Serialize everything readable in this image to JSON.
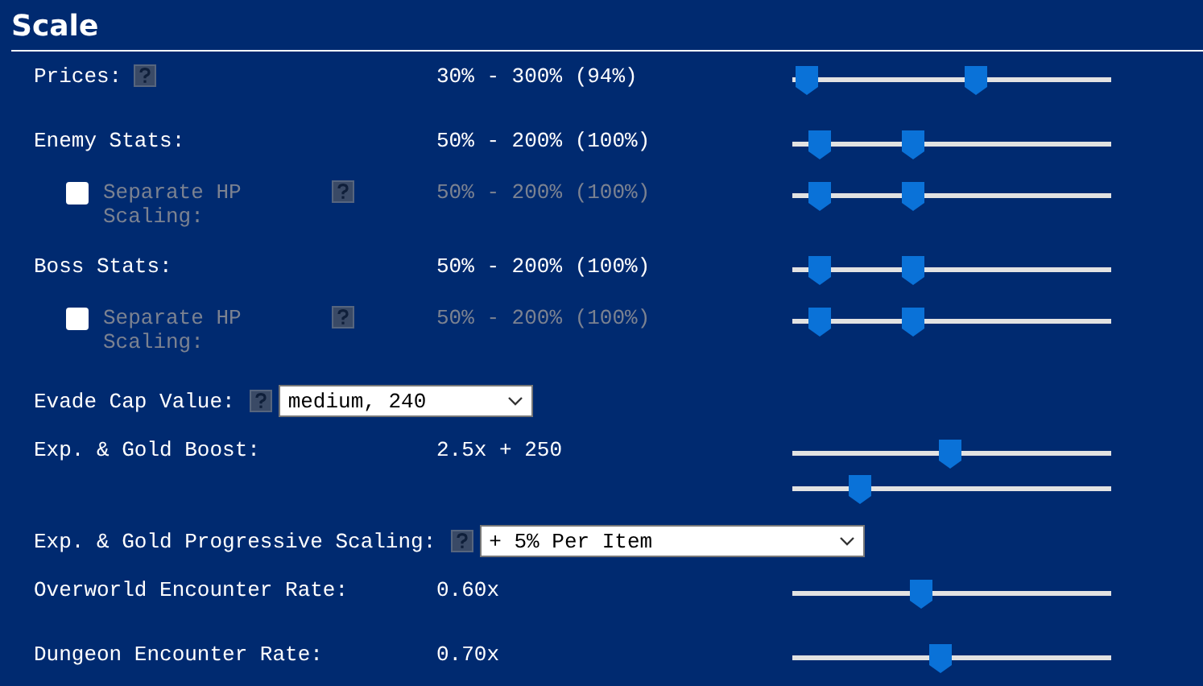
{
  "section": {
    "title": "Scale"
  },
  "rows": [
    {
      "kind": "range",
      "label": "Prices:",
      "help": true,
      "value": "30% - 300% (94%)",
      "disabled": false,
      "sliders": [
        {
          "thumbs": [
            {
              "level": 0.045
            },
            {
              "level": 0.576
            }
          ]
        }
      ]
    },
    {
      "kind": "range",
      "label": "Enemy Stats:",
      "help": false,
      "value": "50% - 200% (100%)",
      "disabled": false,
      "sliders": [
        {
          "thumbs": [
            {
              "level": 0.086
            },
            {
              "level": 0.379
            }
          ]
        }
      ]
    },
    {
      "kind": "toggle",
      "label": "Separate HP Scaling:",
      "checked": false,
      "help": true,
      "value": "50% - 200% (100%)",
      "disabled": true,
      "sliders": [
        {
          "thumbs": [
            {
              "level": 0.086
            },
            {
              "level": 0.379
            }
          ]
        }
      ]
    },
    {
      "kind": "range",
      "label": "Boss Stats:",
      "help": false,
      "value": "50% - 200% (100%)",
      "disabled": false,
      "sliders": [
        {
          "thumbs": [
            {
              "level": 0.086
            },
            {
              "level": 0.379
            }
          ]
        }
      ]
    },
    {
      "kind": "toggle",
      "label": "Separate HP Scaling:",
      "checked": false,
      "help": true,
      "value": "50% - 200% (100%)",
      "disabled": true,
      "sliders": [
        {
          "thumbs": [
            {
              "level": 0.086
            },
            {
              "level": 0.379
            }
          ]
        }
      ]
    },
    {
      "kind": "select",
      "label": "Evade Cap Value:",
      "help": true,
      "value": "medium, 240"
    },
    {
      "kind": "range",
      "label": "Exp. & Gold Boost:",
      "help": false,
      "value": "2.5x + 250",
      "disabled": false,
      "sliders": [
        {
          "thumbs": [
            {
              "level": 0.495
            }
          ]
        },
        {
          "thumbs": [
            {
              "level": 0.212
            }
          ]
        }
      ]
    },
    {
      "kind": "select",
      "label": "Exp. & Gold Progressive Scaling:",
      "help": true,
      "value": "+ 5% Per Item"
    },
    {
      "kind": "range",
      "label": "Overworld Encounter Rate:",
      "help": false,
      "value": "0.60x",
      "disabled": false,
      "sliders": [
        {
          "thumbs": [
            {
              "level": 0.404
            }
          ]
        }
      ]
    },
    {
      "kind": "range",
      "label": "Dungeon Encounter Rate:",
      "help": false,
      "value": "0.70x",
      "disabled": false,
      "sliders": [
        {
          "thumbs": [
            {
              "level": 0.465
            }
          ]
        }
      ]
    }
  ]
}
